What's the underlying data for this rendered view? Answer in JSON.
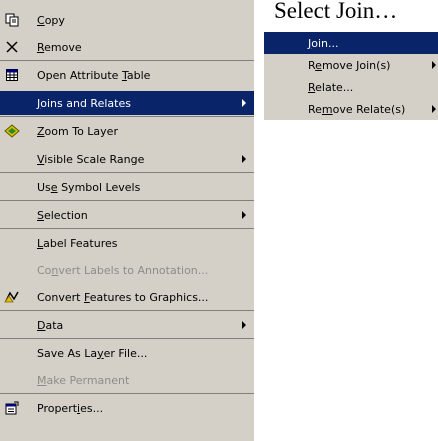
{
  "title": "Select Join…",
  "menu": {
    "items": [
      {
        "pre": "",
        "u": "C",
        "post": "opy",
        "icon": "copy-icon"
      },
      {
        "pre": "",
        "u": "R",
        "post": "emove",
        "icon": "remove-x-icon"
      },
      {
        "pre": "Open Attribute ",
        "u": "T",
        "post": "able",
        "icon": "table-icon"
      },
      {
        "pre": "",
        "u": "J",
        "post": "oins and Relates"
      },
      {
        "pre": "",
        "u": "Z",
        "post": "oom To Layer",
        "icon": "zoom-to-layer-icon"
      },
      {
        "pre": "",
        "u": "V",
        "post": "isible Scale Range"
      },
      {
        "pre": "Us",
        "u": "e",
        "post": " Symbol Levels"
      },
      {
        "pre": "",
        "u": "S",
        "post": "election"
      },
      {
        "pre": "",
        "u": "L",
        "post": "abel Features"
      },
      {
        "pre": "Co",
        "u": "n",
        "post": "vert Labels to Annotation..."
      },
      {
        "pre": "Convert ",
        "u": "F",
        "post": "eatures to Graphics...",
        "icon": "convert-graphics-icon"
      },
      {
        "pre": "",
        "u": "D",
        "post": "ata"
      },
      {
        "pre": "Save As La",
        "u": "y",
        "post": "er File..."
      },
      {
        "pre": "",
        "u": "M",
        "post": "ake Permanent"
      },
      {
        "pre": "Propert",
        "u": "i",
        "post": "es...",
        "icon": "properties-icon"
      }
    ]
  },
  "submenu": {
    "items": [
      {
        "pre": "",
        "u": "J",
        "post": "oin..."
      },
      {
        "pre": "R",
        "u": "e",
        "post": "move Join(s)"
      },
      {
        "pre": "",
        "u": "R",
        "post": "elate..."
      },
      {
        "pre": "Re",
        "u": "m",
        "post": "ove Relate(s)"
      }
    ]
  },
  "colors": {
    "menu_bg": "#d4d0c8",
    "highlight": "#0a246a",
    "disabled_text": "#8c8c8c"
  }
}
